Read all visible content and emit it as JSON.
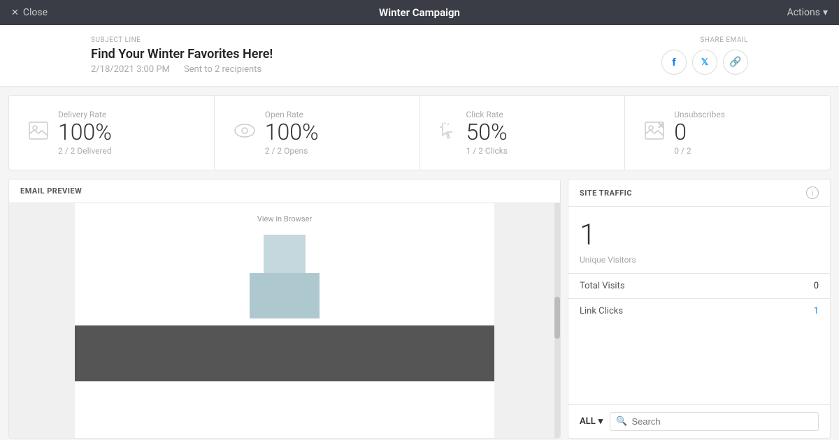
{
  "topBar": {
    "closeLabel": "Close",
    "title": "Winter Campaign",
    "actionsLabel": "Actions"
  },
  "subjectArea": {
    "subjectLineLabel": "SUBJECT LINE",
    "subjectTitle": "Find Your Winter Favorites Here!",
    "date": "2/18/2021 3:00 PM",
    "recipients": "Sent to 2 recipients",
    "shareLabel": "SHARE EMAIL"
  },
  "stats": [
    {
      "label": "Delivery Rate",
      "value": "100%",
      "sub": "2 / 2 Delivered",
      "icon": "image-icon"
    },
    {
      "label": "Open Rate",
      "value": "100%",
      "sub": "2 / 2 Opens",
      "icon": "eye-icon"
    },
    {
      "label": "Click Rate",
      "value": "50%",
      "sub": "1 / 2 Clicks",
      "icon": "cursor-icon"
    },
    {
      "label": "Unsubscribes",
      "value": "0",
      "sub": "0 / 2",
      "icon": "unsubscribe-icon"
    }
  ],
  "emailPreview": {
    "headerLabel": "EMAIL PREVIEW",
    "viewInBrowserText": "View in Browser"
  },
  "siteTraffic": {
    "headerLabel": "SITE TRAFFIC",
    "uniqueVisitors": "1",
    "uniqueVisitorsLabel": "Unique Visitors",
    "rows": [
      {
        "label": "Total Visits",
        "value": "0",
        "isBlue": false
      },
      {
        "label": "Link Clicks",
        "value": "1",
        "isBlue": true
      }
    ]
  },
  "filterBar": {
    "dropdownLabel": "ALL",
    "searchPlaceholder": "Search"
  }
}
